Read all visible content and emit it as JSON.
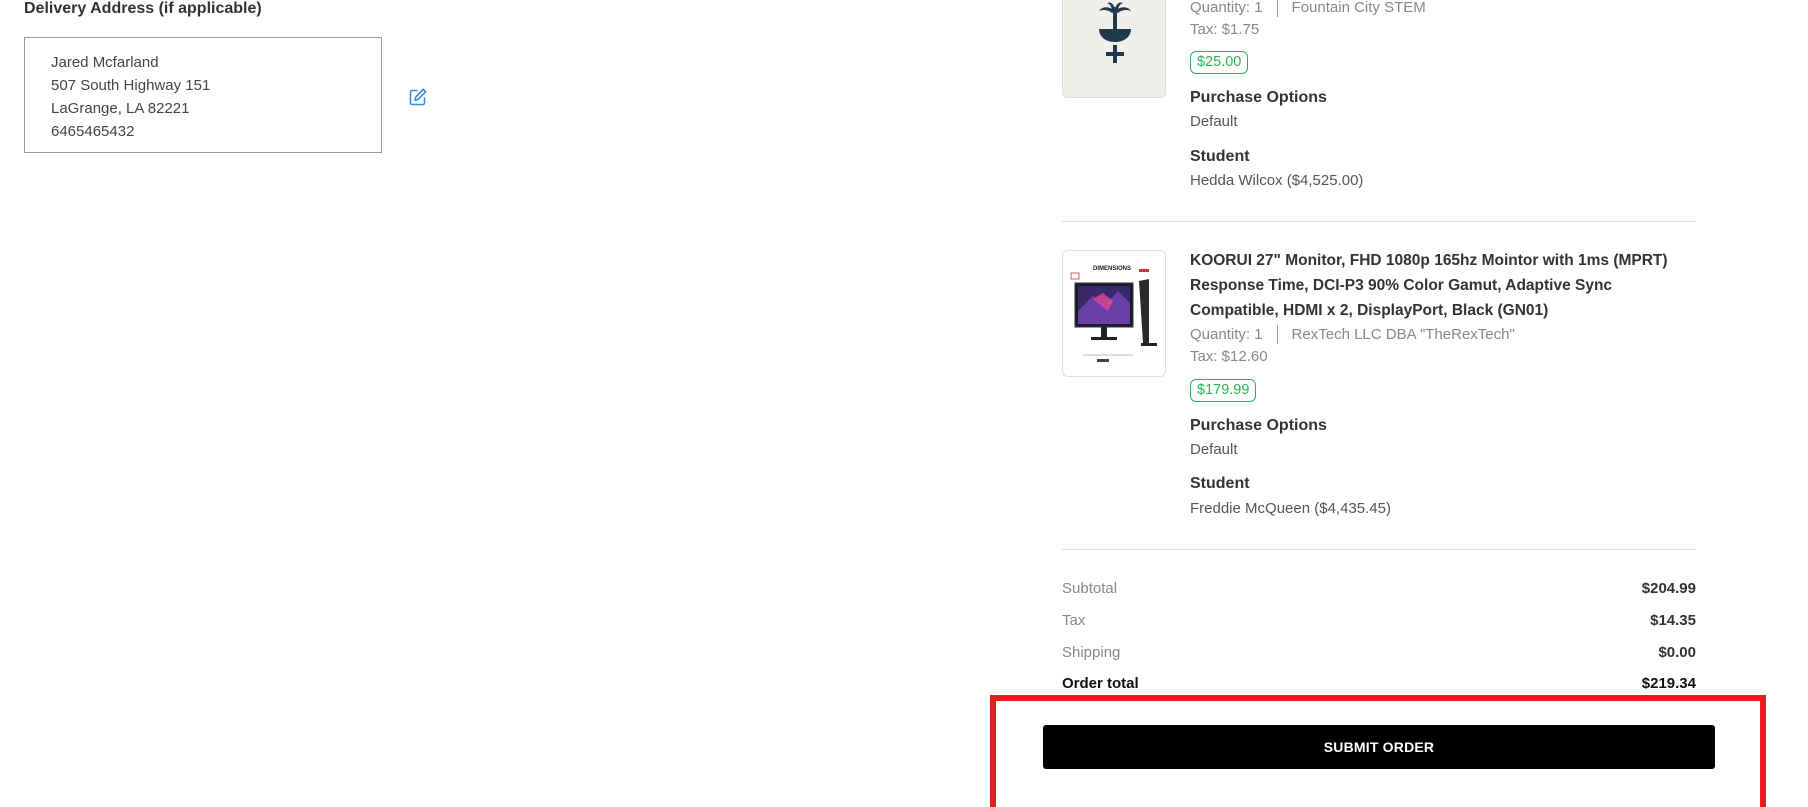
{
  "delivery": {
    "heading": "Delivery Address (if applicable)",
    "address_lines": [
      "Jared Mcfarland",
      "507 South Highway 151",
      "LaGrange, LA 82221",
      "6465465432"
    ],
    "edit_icon": "edit-icon"
  },
  "cart": {
    "items": [
      {
        "image_icon": "fountain-logo",
        "quantity_label": "Quantity: 1",
        "vendor": "Fountain City STEM",
        "tax_label": "Tax: $1.75",
        "price": "$25.00",
        "purchase_options_label": "Purchase Options",
        "purchase_options_value": "Default",
        "student_label": "Student",
        "student_value": "Hedda Wilcox ($4,525.00)"
      },
      {
        "image_icon": "monitor-box-image",
        "title_lines": [
          "KOORUI 27\" Monitor, FHD 1080p 165hz Mointor with 1ms (MPRT)",
          "Response Time, DCI-P3 90% Color Gamut, Adaptive Sync",
          "Compatible, HDMI x 2, DisplayPort, Black (GN01)"
        ],
        "quantity_label": "Quantity: 1",
        "vendor": "RexTech LLC DBA \"TheRexTech\"",
        "tax_label": "Tax: $12.60",
        "price": "$179.99",
        "purchase_options_label": "Purchase Options",
        "purchase_options_value": "Default",
        "student_label": "Student",
        "student_value": "Freddie McQueen ($4,435.45)",
        "packaging_text": "DIMENSIONS"
      }
    ]
  },
  "summary": {
    "subtotal_label": "Subtotal",
    "subtotal_value": "$204.99",
    "tax_label": "Tax",
    "tax_value": "$14.35",
    "shipping_label": "Shipping",
    "shipping_value": "$0.00",
    "total_label": "Order total",
    "total_value": "$219.34"
  },
  "actions": {
    "submit_label": "SUBMIT ORDER"
  },
  "colors": {
    "price_green": "#2fb05a",
    "highlight_red": "#e02020",
    "button_black": "#000000",
    "edit_blue": "#2f8fd8"
  }
}
